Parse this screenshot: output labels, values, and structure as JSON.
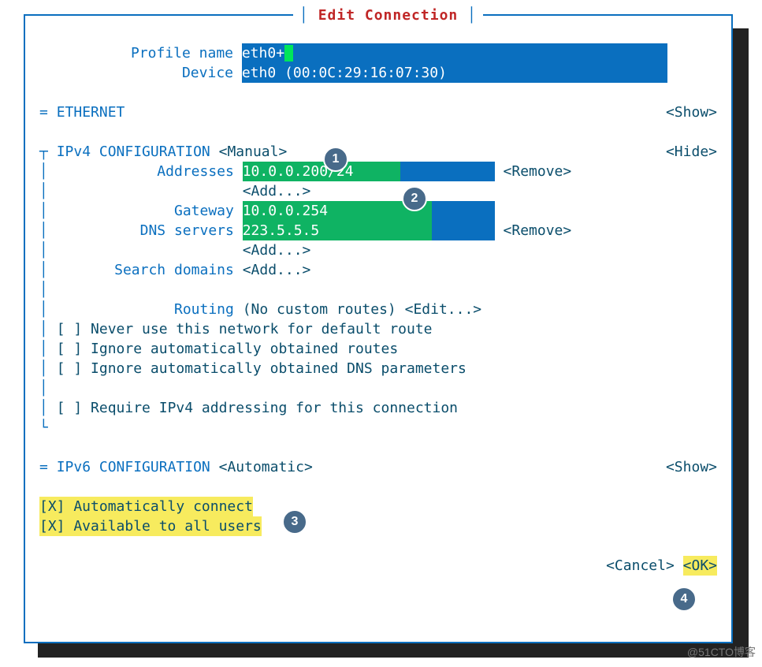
{
  "title": "Edit Connection",
  "profile": {
    "name_label": "Profile name",
    "name_value": "eth0+",
    "device_label": "Device",
    "device_value": "eth0 (00:0C:29:16:07:30)"
  },
  "ethernet": {
    "marker": "=",
    "label": "ETHERNET",
    "toggle": "<Show>"
  },
  "ipv4": {
    "marker": "┬",
    "pipe": "│",
    "corner": "└",
    "label": "IPv4 CONFIGURATION",
    "mode": "<Manual>",
    "toggle": "<Hide>",
    "addresses_label": "Addresses",
    "address_value": "10.0.0.200/24",
    "remove": "<Remove>",
    "add": "<Add...>",
    "gateway_label": "Gateway",
    "gateway_value": "10.0.0.254",
    "dns_label": "DNS servers",
    "dns_value": "223.5.5.5",
    "search_label": "Search domains",
    "routing_label": "Routing",
    "routing_value": "(No custom routes)",
    "edit": "<Edit...>",
    "cb1": "[ ] Never use this network for default route",
    "cb2": "[ ] Ignore automatically obtained routes",
    "cb3": "[ ] Ignore automatically obtained DNS parameters",
    "cb4": "[ ] Require IPv4 addressing for this connection"
  },
  "ipv6": {
    "marker": "=",
    "label": "IPv6 CONFIGURATION",
    "mode": "<Automatic>",
    "toggle": "<Show>"
  },
  "auto": {
    "cb1": "[X] Automatically connect",
    "cb2": "[X] Available to all users"
  },
  "buttons": {
    "cancel": "<Cancel>",
    "ok": "<OK>"
  },
  "badges": {
    "b1": "1",
    "b2": "2",
    "b3": "3",
    "b4": "4"
  },
  "watermark": "@51CTO博客"
}
